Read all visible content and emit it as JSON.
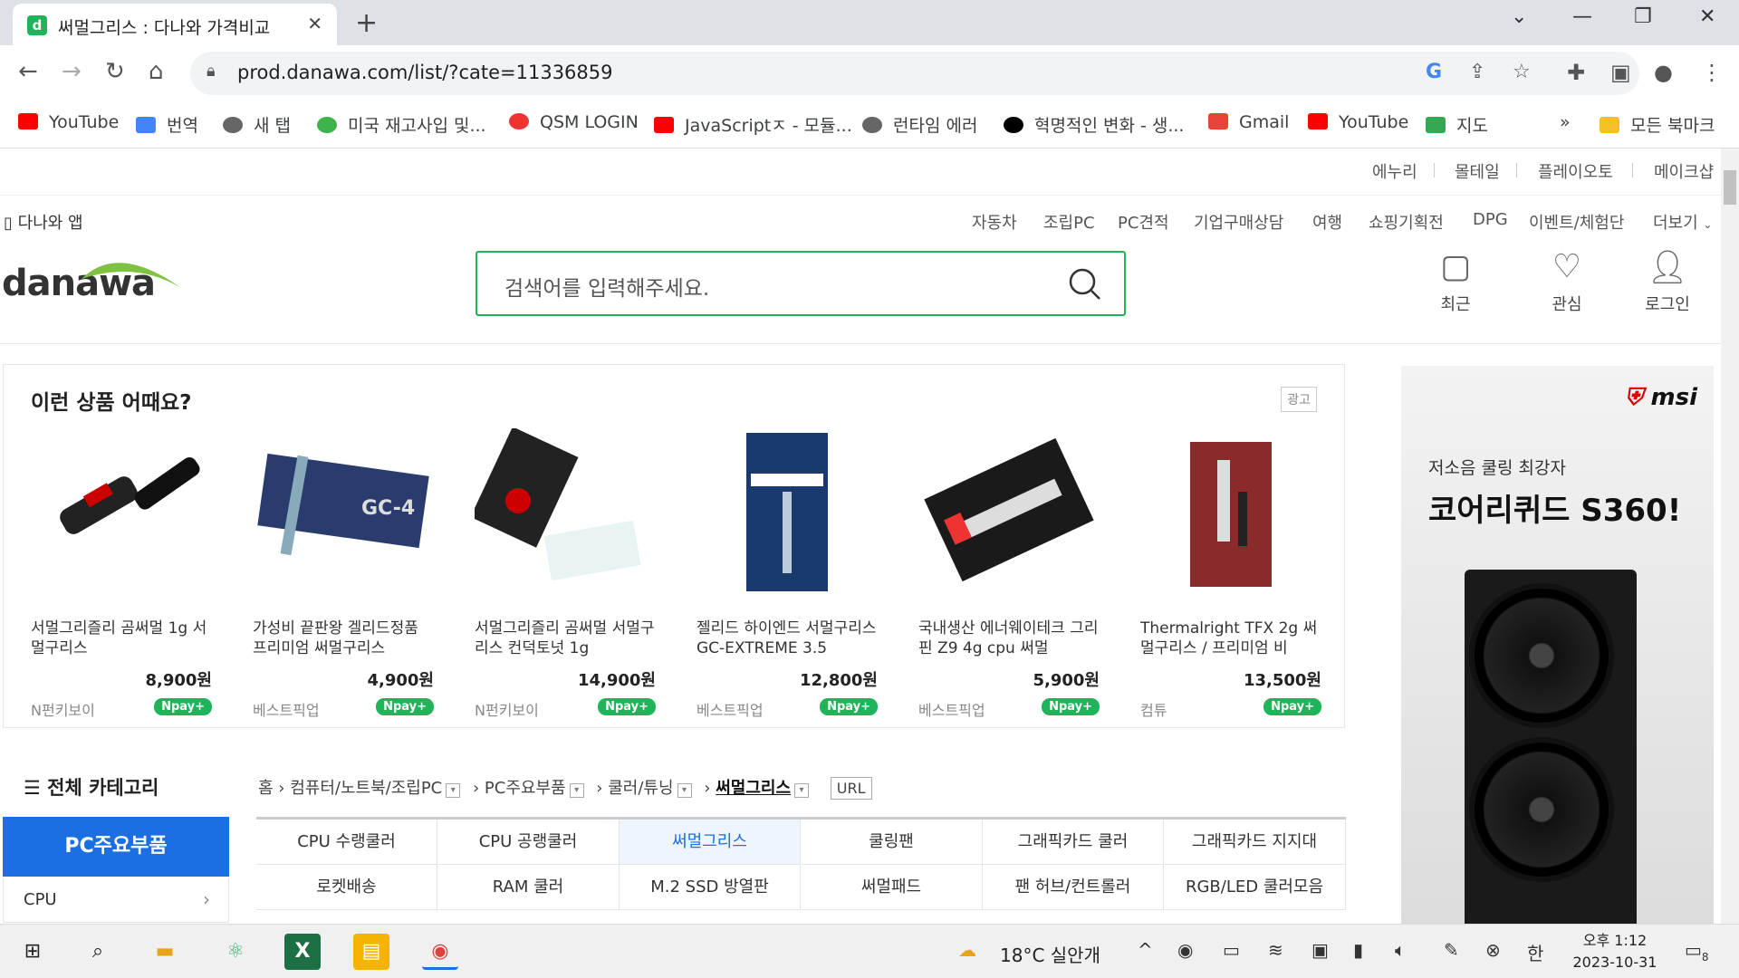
{
  "browser": {
    "tab_title": "써멀그리스 : 다나와 가격비교",
    "favicon_letter": "d",
    "url": "prod.danawa.com/list/?cate=11336859",
    "bookmarks": [
      "YouTube",
      "번역",
      "새 탭",
      "미국 재고사입 및...",
      "QSM LOGIN",
      "JavaScriptㅈ - 모듈...",
      "런타임 에러",
      "혁명적인 변화 - 생...",
      "Gmail",
      "YouTube",
      "지도"
    ],
    "bookmarks_more": "»",
    "all_bookmarks": "모든 북마크"
  },
  "site": {
    "top_links": [
      "에누리",
      "몰테일",
      "플레이오토",
      "메이크샵"
    ],
    "app_link": "다나와 앱",
    "categories": [
      "자동차",
      "조립PC",
      "PC견적",
      "기업구매상담",
      "여행",
      "쇼핑기획전",
      "DPG",
      "이벤트/체험단",
      "더보기"
    ],
    "logo": "danawa",
    "search_placeholder": "검색어를 입력해주세요.",
    "header_icons": [
      "최근",
      "관심",
      "로그인"
    ]
  },
  "recommend": {
    "heading": "이런 상품 어때요?",
    "ad_tag": "광고",
    "products": [
      {
        "name": "서멀그리즐리 곰써멀 1g 서멀구리스",
        "price": "8,900원",
        "seller": "N펀키보이",
        "pay": "Npay+"
      },
      {
        "name": "가성비 끝판왕 겔리드정품 프리미엄 써멀구리스",
        "price": "4,900원",
        "seller": "베스트픽업",
        "pay": "Npay+"
      },
      {
        "name": "서멀그리즐리 곰써멀 서멀구리스 컨덕토넛 1g",
        "price": "14,900원",
        "seller": "N펀키보이",
        "pay": "Npay+"
      },
      {
        "name": "젤리드 하이엔드 서멀구리스 GC-EXTREME 3.5",
        "price": "12,800원",
        "seller": "베스트픽업",
        "pay": "Npay+"
      },
      {
        "name": "국내생산 에너웨이테크 그리핀 Z9 4g cpu 써멀",
        "price": "5,900원",
        "seller": "베스트픽업",
        "pay": "Npay+"
      },
      {
        "name": "Thermalright TFX 2g 써멀구리스 / 프리미엄 비",
        "price": "13,500원",
        "seller": "컴튜",
        "pay": "Npay+"
      }
    ]
  },
  "category_nav": {
    "all_label": "전체 카테고리",
    "breadcrumb": [
      "홈",
      "컴퓨터/노트북/조립PC",
      "PC주요부품",
      "쿨러/튜닝",
      "써멀그리스"
    ],
    "url_btn": "URL",
    "side_header": "PC주요부품",
    "side_item": "CPU",
    "grid": [
      "CPU 수랭쿨러",
      "CPU 공랭쿨러",
      "써멀그리스",
      "쿨링팬",
      "그래픽카드 쿨러",
      "그래픽카드 지지대",
      "로켓배송",
      "RAM 쿨러",
      "M.2 SSD 방열판",
      "써멀패드",
      "팬 허브/컨트롤러",
      "RGB/LED 쿨러모음"
    ],
    "active_index": 2
  },
  "right_ad": {
    "brand": "msi",
    "line1": "저소음 쿨링 최강자",
    "line2": "코어리퀴드 S360!"
  },
  "taskbar": {
    "weather": "18°C 실안개",
    "ime": "한",
    "time": "오후 1:12",
    "date": "2023-10-31",
    "notif_count": "8"
  }
}
